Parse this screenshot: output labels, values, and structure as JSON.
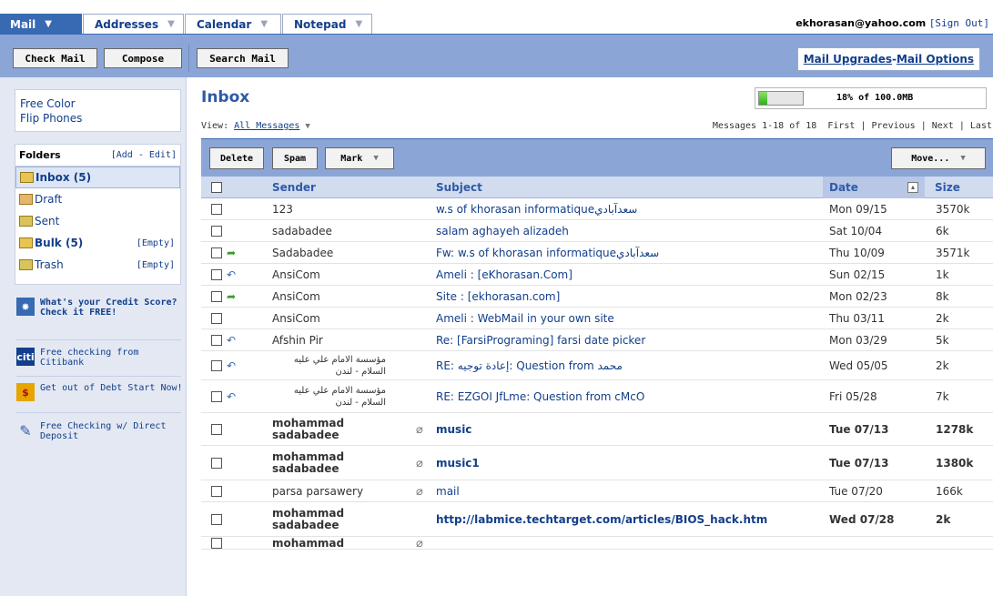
{
  "nav": {
    "tabs": [
      {
        "label": "Mail"
      },
      {
        "label": "Addresses"
      },
      {
        "label": "Calendar"
      },
      {
        "label": "Notepad"
      }
    ],
    "account_email": "ekhorasan@yahoo.com",
    "sign_out": "[Sign Out]"
  },
  "toolbar": {
    "check_mail": "Check Mail",
    "compose": "Compose",
    "search_mail": "Search Mail",
    "upgrades": "Mail Upgrades",
    "separator": " - ",
    "options": "Mail Options"
  },
  "sidebar": {
    "promo": "Free Color\nFlip Phones",
    "folders_title": "Folders",
    "folders_edit": "[Add - Edit]",
    "folders": [
      {
        "name": "Inbox (5)",
        "bold": true,
        "empty": ""
      },
      {
        "name": "Draft",
        "bold": false,
        "empty": ""
      },
      {
        "name": "Sent",
        "bold": false,
        "empty": ""
      },
      {
        "name": "Bulk (5)",
        "bold": true,
        "empty": "[Empty]"
      },
      {
        "name": "Trash",
        "bold": false,
        "empty": "[Empty]"
      }
    ],
    "ads": [
      {
        "text": "What's your Credit Score? Check it FREE!",
        "icon": "star-icon",
        "color": "#3869b3"
      },
      {
        "text": "Free checking from Citibank",
        "icon": "citi-icon",
        "color": "#123e8a"
      },
      {
        "text": "Get out of Debt Start Now!",
        "icon": "dollar-icon",
        "color": "#e8a400"
      },
      {
        "text": "Free Checking w/ Direct Deposit",
        "icon": "pen-icon",
        "color": "#2f5aa7"
      }
    ]
  },
  "inbox": {
    "title": "Inbox",
    "quota_text": "18% of 100.0MB",
    "quota_fraction": 0.18,
    "view_label": "View:",
    "view_value": "All Messages",
    "messages_range": "Messages 1-18 of 18",
    "pager": [
      "First",
      "Previous",
      "Next",
      "Last"
    ]
  },
  "actions": {
    "delete": "Delete",
    "spam": "Spam",
    "mark": "Mark",
    "move": "Move..."
  },
  "columns": {
    "sender": "Sender",
    "subject": "Subject",
    "date": "Date",
    "size": "Size"
  },
  "messages": [
    {
      "sender": "123",
      "subject": "w.s of khorasan informatiqueسعدآبادي",
      "date": "Mon 09/15",
      "size": "3570k",
      "status": "",
      "clip": false,
      "bold": false,
      "rtl": false
    },
    {
      "sender": "sadabadee",
      "subject": "salam aghayeh alizadeh",
      "date": "Sat 10/04",
      "size": "6k",
      "status": "",
      "clip": false,
      "bold": false,
      "rtl": false
    },
    {
      "sender": "Sadabadee",
      "subject": "Fw: w.s of khorasan informatiqueسعدآبادي",
      "date": "Thu 10/09",
      "size": "3571k",
      "status": "forwarded",
      "clip": false,
      "bold": false,
      "rtl": false
    },
    {
      "sender": "AnsiCom",
      "subject": "Ameli : [eKhorasan.Com]",
      "date": "Sun 02/15",
      "size": "1k",
      "status": "replied",
      "clip": false,
      "bold": false,
      "rtl": false
    },
    {
      "sender": "AnsiCom",
      "subject": "Site : [ekhorasan.com]",
      "date": "Mon 02/23",
      "size": "8k",
      "status": "forwarded",
      "clip": false,
      "bold": false,
      "rtl": false
    },
    {
      "sender": "AnsiCom",
      "subject": "Ameli : WebMail in your own site",
      "date": "Thu 03/11",
      "size": "2k",
      "status": "",
      "clip": false,
      "bold": false,
      "rtl": false
    },
    {
      "sender": "Afshin Pir",
      "subject": "Re: [FarsiPrograming] farsi date picker",
      "date": "Mon 03/29",
      "size": "5k",
      "status": "replied",
      "clip": false,
      "bold": false,
      "rtl": false
    },
    {
      "sender": "مؤسسة الامام علي عليه السلام - لندن",
      "subject": "RE: إعادة توجيه: Question from محمد",
      "date": "Wed 05/05",
      "size": "2k",
      "status": "replied",
      "clip": false,
      "bold": false,
      "rtl": true
    },
    {
      "sender": "مؤسسة الامام علي عليه السلام - لندن",
      "subject": "RE: EZGOI JfLme: Question from cMcO",
      "date": "Fri 05/28",
      "size": "7k",
      "status": "replied",
      "clip": false,
      "bold": false,
      "rtl": true
    },
    {
      "sender": "mohammad sadabadee",
      "subject": "music",
      "date": "Tue 07/13",
      "size": "1278k",
      "status": "",
      "clip": true,
      "bold": true,
      "rtl": false
    },
    {
      "sender": "mohammad sadabadee",
      "subject": "music1",
      "date": "Tue 07/13",
      "size": "1380k",
      "status": "",
      "clip": true,
      "bold": true,
      "rtl": false
    },
    {
      "sender": "parsa parsawery",
      "subject": "mail",
      "date": "Tue 07/20",
      "size": "166k",
      "status": "",
      "clip": true,
      "bold": false,
      "rtl": false
    },
    {
      "sender": "mohammad sadabadee",
      "subject": "http://labmice.techtarget.com/articles/BIOS_hack.htm",
      "date": "Wed 07/28",
      "size": "2k",
      "status": "",
      "clip": false,
      "bold": true,
      "rtl": false
    },
    {
      "sender": "mohammad",
      "subject": "",
      "date": "",
      "size": "",
      "status": "",
      "clip": true,
      "bold": true,
      "rtl": false
    }
  ],
  "colors": {
    "brand_blue": "#3869b3",
    "bar_blue": "#8ba6d6",
    "sidebar_bg": "#e3e8f3",
    "link": "#123e8a"
  }
}
